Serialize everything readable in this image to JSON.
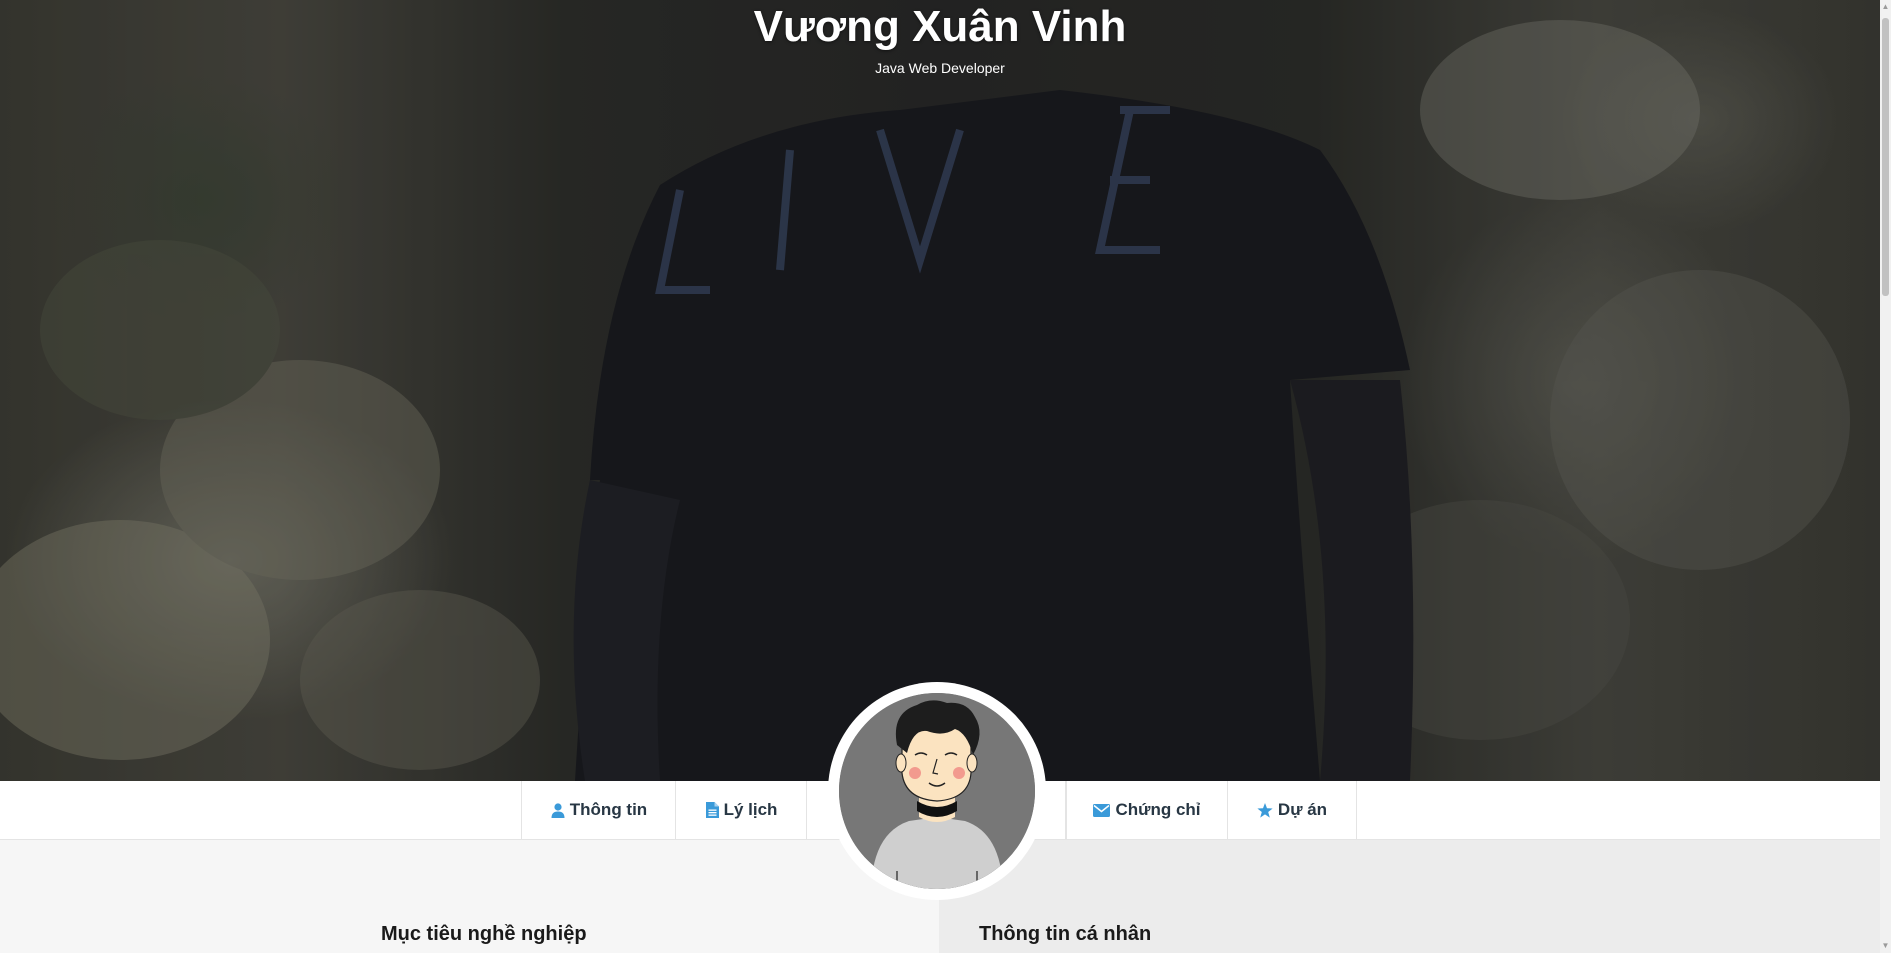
{
  "hero": {
    "name": "Vương Xuân Vinh",
    "role": "Java Web Developer",
    "background_description_shirt_text": "LIVE"
  },
  "nav": {
    "items": [
      {
        "label": "Thông tin",
        "icon": "user-icon"
      },
      {
        "label": "Lý lịch",
        "icon": "document-icon"
      },
      {
        "label": "Chứng chỉ",
        "icon": "envelope-icon"
      },
      {
        "label": "Dự án",
        "icon": "star-icon"
      }
    ],
    "accent_color": "#3a9ad9",
    "text_color": "#283744"
  },
  "avatar": {
    "alt": "avatar"
  },
  "sections": {
    "career_title": "Mục tiêu nghề nghiệp",
    "personal_title": "Thông tin cá nhân"
  }
}
